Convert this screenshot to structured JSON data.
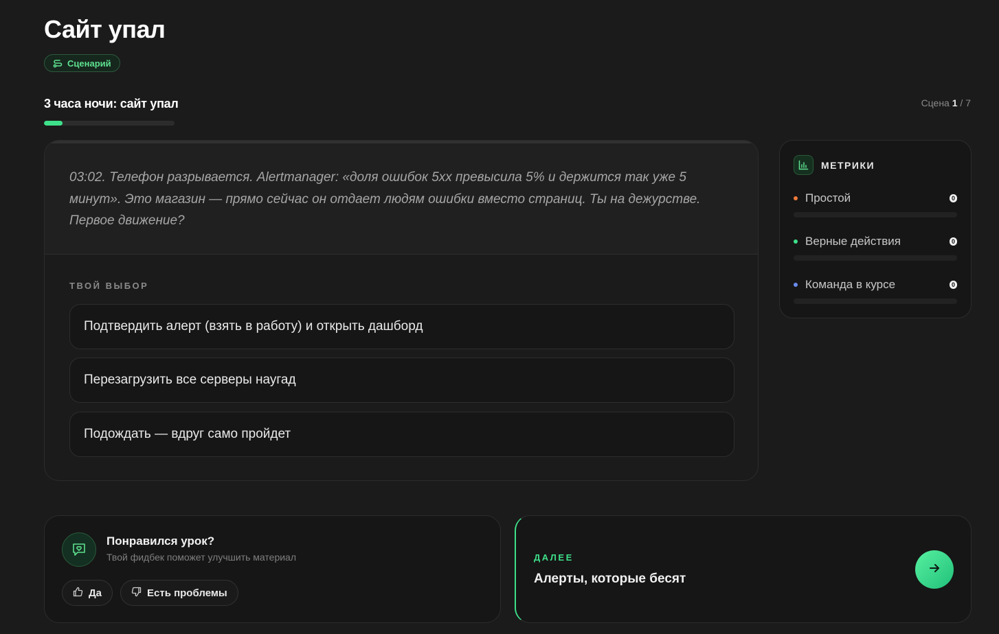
{
  "page": {
    "title": "Сайт упал",
    "tag_label": "Сценарий"
  },
  "scene": {
    "title": "3 часа ночи: сайт упал",
    "counter_prefix": "Сцена",
    "current": "1",
    "separator": "/",
    "total": "7",
    "progress_fraction": 0.14,
    "narrative": "03:02. Телефон разрывается. Alertmanager: «доля ошибок 5xx превысила 5% и держится так уже 5 минут». Это магазин — прямо сейчас он отдает людям ошибки вместо страниц. Ты на дежурстве. Первое движение?",
    "choice_label": "ТВОЙ ВЫБОР",
    "choices": [
      {
        "label": "Подтвердить алерт (взять в работу) и открыть дашборд"
      },
      {
        "label": "Перезагрузить все серверы наугад"
      },
      {
        "label": "Подождать — вдруг само пройдет"
      }
    ]
  },
  "metrics": {
    "title": "МЕТРИКИ",
    "items": [
      {
        "name": "Простой",
        "value": "0",
        "dot_color": "#f07a3a",
        "fraction": 0
      },
      {
        "name": "Верные действия",
        "value": "0",
        "dot_color": "#3ee08a",
        "fraction": 0
      },
      {
        "name": "Команда в курсе",
        "value": "0",
        "dot_color": "#6b8cf0",
        "fraction": 0
      }
    ]
  },
  "feedback": {
    "title": "Понравился урок?",
    "subtitle": "Твой фидбек поможет улучшить материал",
    "yes_label": "Да",
    "problems_label": "Есть проблемы"
  },
  "next": {
    "label": "ДАЛЕЕ",
    "title": "Алерты, которые бесят"
  },
  "colors": {
    "accent": "#3ee08a",
    "background": "#1b1b1b",
    "card": "#161616"
  }
}
